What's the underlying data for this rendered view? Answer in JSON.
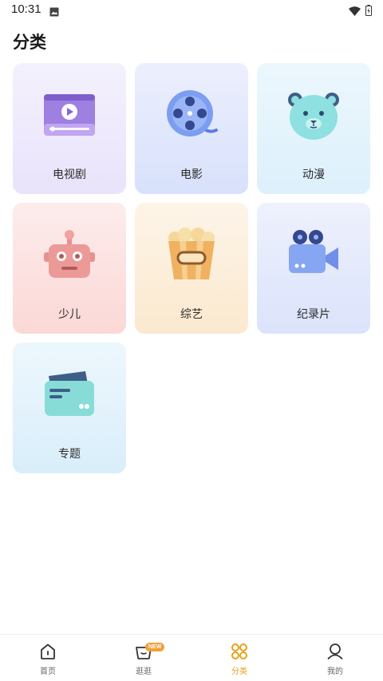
{
  "status_bar": {
    "time": "10:31"
  },
  "page": {
    "title": "分类"
  },
  "categories": [
    {
      "label": "电视剧",
      "icon": "tv-video-icon"
    },
    {
      "label": "电影",
      "icon": "film-reel-icon"
    },
    {
      "label": "动漫",
      "icon": "cartoon-bear-icon"
    },
    {
      "label": "少儿",
      "icon": "robot-icon"
    },
    {
      "label": "综艺",
      "icon": "popcorn-icon"
    },
    {
      "label": "纪录片",
      "icon": "movie-camera-icon"
    },
    {
      "label": "专题",
      "icon": "card-folder-icon"
    }
  ],
  "tabbar": {
    "items": [
      {
        "label": "首页",
        "icon": "home-icon"
      },
      {
        "label": "逛逛",
        "icon": "basket-icon",
        "badge": "NEW"
      },
      {
        "label": "分类",
        "icon": "category-grid-icon",
        "active": true
      },
      {
        "label": "我的",
        "icon": "profile-icon"
      }
    ]
  },
  "colors": {
    "accent": "#e6a11c",
    "badge": "#f1a03a"
  }
}
